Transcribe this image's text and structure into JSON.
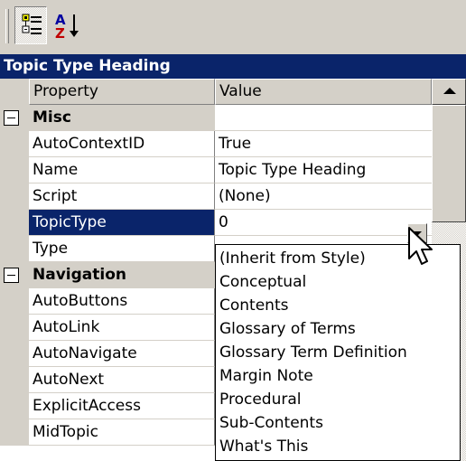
{
  "toolbar": {
    "categorized_icon": "categorized-icon",
    "alphabetical_icon": "alphabetical-sort-icon"
  },
  "title": "Topic Type Heading",
  "header": {
    "property": "Property",
    "value": "Value"
  },
  "rows": [
    {
      "kind": "category",
      "name": "Misc",
      "value": ""
    },
    {
      "kind": "prop",
      "name": "AutoContextID",
      "value": "True"
    },
    {
      "kind": "prop",
      "name": "Name",
      "value": "Topic Type Heading"
    },
    {
      "kind": "prop",
      "name": "Script",
      "value": "(None)"
    },
    {
      "kind": "prop",
      "name": "TopicType",
      "value": "0",
      "selected": true
    },
    {
      "kind": "prop",
      "name": "Type",
      "value": ""
    },
    {
      "kind": "category",
      "name": "Navigation",
      "value": ""
    },
    {
      "kind": "prop",
      "name": "AutoButtons",
      "value": ""
    },
    {
      "kind": "prop",
      "name": "AutoLink",
      "value": ""
    },
    {
      "kind": "prop",
      "name": "AutoNavigate",
      "value": ""
    },
    {
      "kind": "prop",
      "name": "AutoNext",
      "value": ""
    },
    {
      "kind": "prop",
      "name": "ExplicitAccess",
      "value": ""
    },
    {
      "kind": "prop",
      "name": "MidTopic",
      "value": ""
    }
  ],
  "dropdown_options": [
    "(Inherit from Style)",
    "Conceptual",
    "Contents",
    "Glossary of Terms",
    "Glossary Term Definition",
    "Margin Note",
    "Procedural",
    "Sub-Contents",
    "What's This"
  ],
  "colors": {
    "title_bg": "#0a246a",
    "face": "#d4d0c8",
    "selection": "#0a246a"
  }
}
